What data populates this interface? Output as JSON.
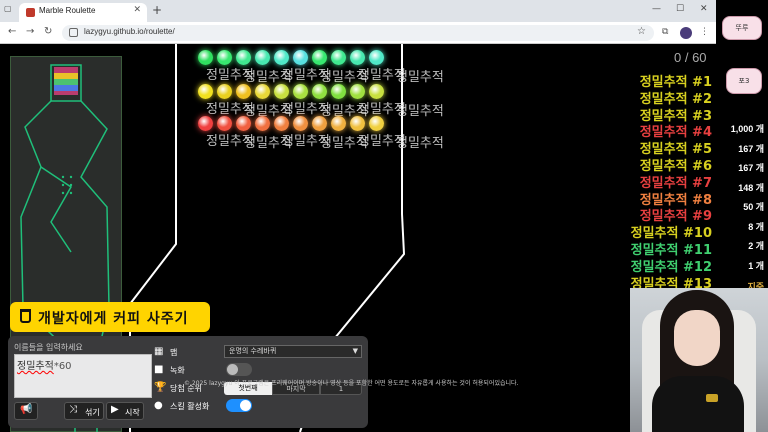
{
  "browser": {
    "tab_title": "Marble Roulette",
    "tab_close": "✕",
    "new_tab": "+",
    "url": "lazygyu.github.io/roulette/",
    "controls": [
      "—",
      "☐",
      "✕"
    ],
    "nav": [
      "←",
      "→",
      "↻"
    ]
  },
  "game": {
    "counter": "0 / 60",
    "name_tag": "정밀추적",
    "colors": {
      "row1": "#38e870",
      "row2": "#f0d020",
      "row3": "#f04040",
      "track": "#ffffff",
      "minimap_track": "#1fbf7a"
    }
  },
  "ranking": [
    {
      "name": "정밀추적 #1",
      "color": "#d8d020"
    },
    {
      "name": "정밀추적 #2",
      "color": "#d8d020"
    },
    {
      "name": "정밀추적 #3",
      "color": "#d8d020"
    },
    {
      "name": "정밀추적 #4",
      "color": "#e84040"
    },
    {
      "name": "정밀추적 #5",
      "color": "#d8d020"
    },
    {
      "name": "정밀추적 #6",
      "color": "#d8d020"
    },
    {
      "name": "정밀추적 #7",
      "color": "#e84040"
    },
    {
      "name": "정밀추적 #8",
      "color": "#f08040"
    },
    {
      "name": "정밀추적 #9",
      "color": "#e84040"
    },
    {
      "name": "정밀추적 #10",
      "color": "#d8d020"
    },
    {
      "name": "정밀추적 #11",
      "color": "#40d070"
    },
    {
      "name": "정밀추적 #12",
      "color": "#40d070"
    },
    {
      "name": "정밀추적 #13",
      "color": "#d8d020"
    }
  ],
  "coffee": {
    "label": "개발자에게 커피 사주기"
  },
  "panel": {
    "name_label": "이름들을 입력하세요",
    "name_value": "정밀추적",
    "name_suffix": "*60",
    "shuffle_label": "섞기",
    "start_label": "시작",
    "map_label": "맵",
    "map_value": "운명의 수레바퀴",
    "record_label": "녹화",
    "winner_label": "당첨 순위",
    "first_label": "첫번째",
    "last_label": "마지막",
    "rank_value": "1",
    "skill_label": "스킬 활성화"
  },
  "footer": "© 2025 lazygyu 이 프로그램은 프리웨어이며 방송이나 영상 등을 포함한 어떤 용도로든 자유롭게 사용하는 것이 허용되어있습니다.",
  "overlay": {
    "counts": [
      "1,000 개",
      "167 개",
      "167 개",
      "148 개",
      "50 개",
      "8 개",
      "2 개",
      "1 개"
    ],
    "sticker_top": "뚜루",
    "sticker_mid": "포3",
    "partial_text": "지중"
  }
}
